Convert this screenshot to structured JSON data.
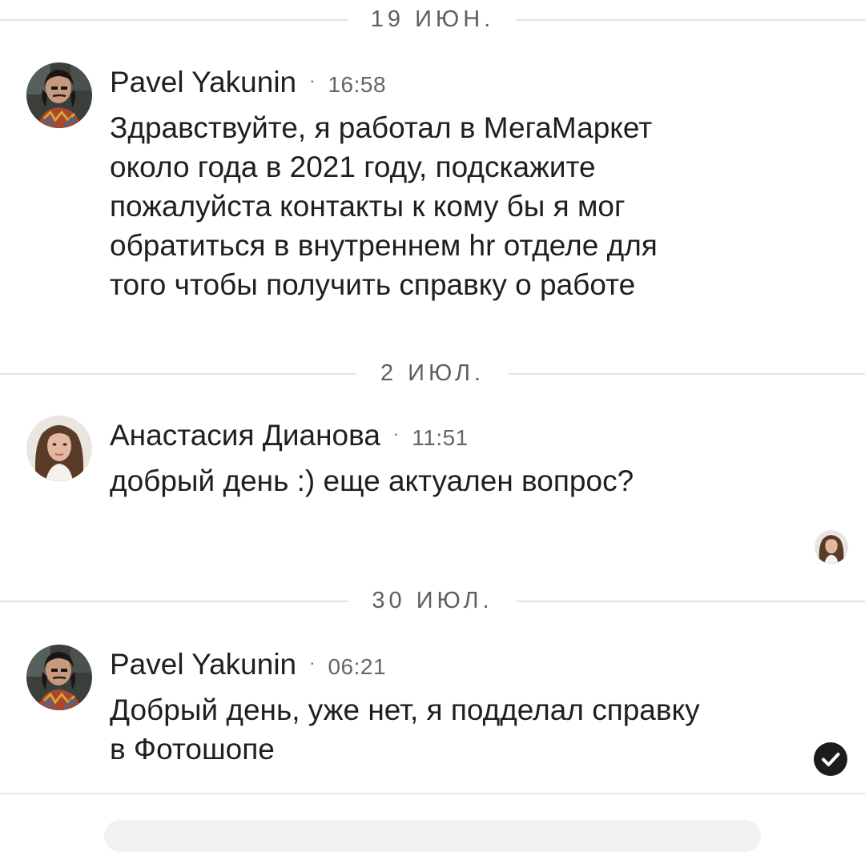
{
  "dates": [
    "19 ИЮН.",
    "2 ИЮЛ.",
    "30 ИЮЛ."
  ],
  "messages": [
    {
      "author": "Pavel Yakunin",
      "time": "16:58",
      "text": "Здравствуйте, я работал в МегаМаркет\nоколо года в 2021 году, подскажите\nпожалуйста контакты к кому бы я мог\nобратиться в внутреннем hr отделе для\nтого чтобы получить справку о работе"
    },
    {
      "author": "Анастасия Дианова",
      "time": "11:51",
      "text": "добрый день :) еще актуален вопрос?"
    },
    {
      "author": "Pavel Yakunin",
      "time": "06:21",
      "text": "Добрый день, уже нет, я подделал справку\nв Фотошопе"
    }
  ],
  "header_separator": "·",
  "colors": {
    "text": "#1f1f1f",
    "muted": "#666666",
    "divider": "#e3e3e3",
    "check_badge": "#1c1c1c"
  },
  "icons": {
    "read_receipt": "avatar-read-receipt-icon",
    "sent": "check-circle-icon"
  }
}
